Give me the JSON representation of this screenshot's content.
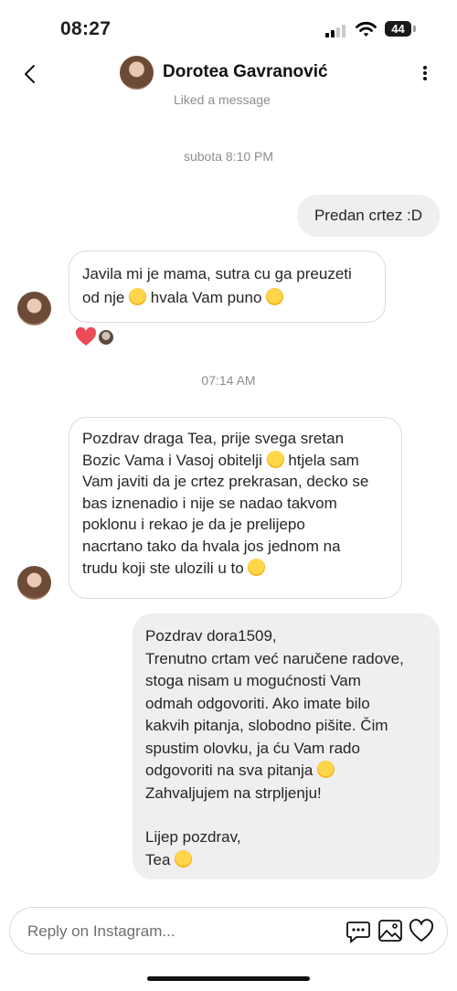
{
  "status_bar": {
    "time": "08:27",
    "battery": "44"
  },
  "header": {
    "contact_name": "Dorotea Gavranović",
    "subtitle": "Liked a message"
  },
  "messages": [
    {
      "type": "timestamp",
      "text": "subota 8:10 PM"
    },
    {
      "type": "outgoing",
      "text": "Predan crtez :D"
    },
    {
      "type": "incoming",
      "lines": [
        "Javila mi je mama, sutra cu ga preuzeti",
        "od nje",
        "hvala Vam puno"
      ]
    },
    {
      "type": "timestamp",
      "text": "07:14 AM"
    },
    {
      "type": "incoming",
      "lines": [
        "Pozdrav draga Tea, prije svega sretan",
        "Bozic Vama i Vasoj obitelji",
        "htjela sam",
        "Vam javiti da je crtez prekrasan, decko se",
        "bas iznenadio i nije se nadao takvom",
        "poklonu i rekao je da je prelijepo",
        "nacrtano tako da hvala jos jednom na",
        "trudu koji ste ulozili u to"
      ]
    },
    {
      "type": "outgoing",
      "lines": [
        "Pozdrav dora1509,",
        "Trenutno crtam već naručene radove,",
        "stoga nisam u mogućnosti Vam",
        "odmah odgovoriti. Ako imate bilo",
        "kakvih pitanja, slobodno pišite. Čim",
        "spustim olovku, ja ću Vam rado",
        "odgovoriti na sva pitanja",
        "Zahvaljujem na strpljenju!",
        "Lijep pozdrav,",
        "Tea"
      ]
    }
  ],
  "reactions": {
    "icon": "heart-icon",
    "color": "#ed4956"
  },
  "composer": {
    "placeholder": "Reply on Instagram..."
  },
  "colors": {
    "outgoing_bubble": "#efeff1",
    "incoming_border": "#dbdbdb",
    "timestamp": "#8a8d91"
  }
}
